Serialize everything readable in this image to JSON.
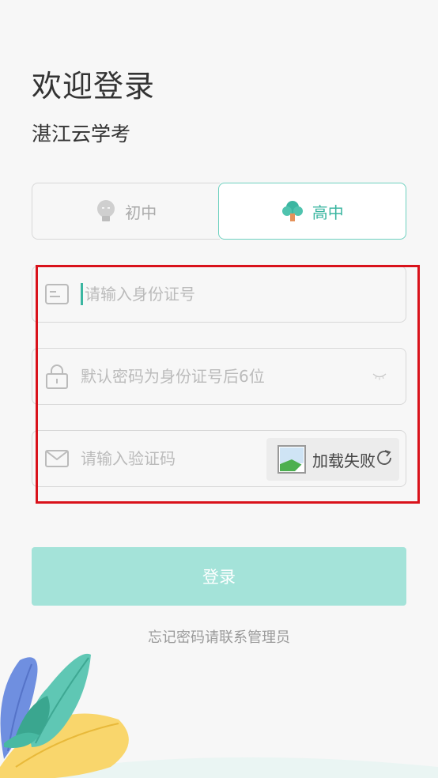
{
  "header": {
    "title": "欢迎登录",
    "subtitle": "湛江云学考"
  },
  "level_toggle": {
    "junior_label": "初中",
    "senior_label": "高中",
    "selected": "高中"
  },
  "form": {
    "id_placeholder": "请输入身份证号",
    "password_placeholder": "默认密码为身份证号后6位",
    "captcha_placeholder": "请输入验证码",
    "captcha_image_text": "加载失败"
  },
  "actions": {
    "login_label": "登录",
    "forgot_text": "忘记密码请联系管理员"
  },
  "colors": {
    "accent": "#3bb6a1",
    "button_bg": "#a4e3d9",
    "highlight": "#d9121b"
  }
}
